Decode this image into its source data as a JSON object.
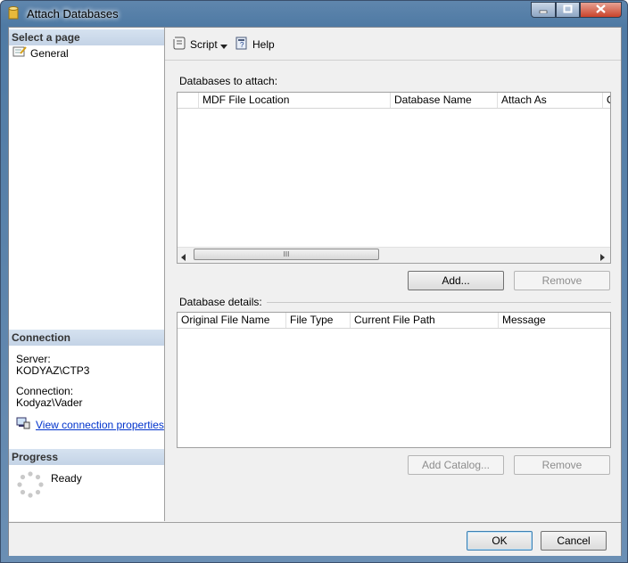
{
  "window": {
    "title": "Attach Databases",
    "icon": "database-cylinder-icon",
    "minimize_icon": "minimize-icon",
    "maximize_icon": "maximize-icon",
    "close_icon": "close-icon"
  },
  "sidebar": {
    "select_page_header": "Select a page",
    "pages": [
      {
        "label": "General",
        "icon": "general-page-icon"
      }
    ],
    "connection_header": "Connection",
    "server_label": "Server:",
    "server_value": "KODYAZ\\CTP3",
    "connection_label": "Connection:",
    "connection_value": "Kodyaz\\Vader",
    "view_connection_link": "View connection properties",
    "progress_header": "Progress",
    "progress_status": "Ready"
  },
  "toolbar": {
    "script_label": "Script",
    "help_label": "Help"
  },
  "databases_to_attach": {
    "label": "Databases to attach:",
    "columns": [
      "",
      "MDF File Location",
      "Database Name",
      "Attach As",
      "O"
    ],
    "rows": [],
    "scroll_grip": "III",
    "add_button": "Add...",
    "remove_button": "Remove"
  },
  "database_details": {
    "label": "Database details:",
    "columns": [
      "Original File Name",
      "File Type",
      "Current File Path",
      "Message"
    ],
    "rows": [],
    "add_catalog_button": "Add Catalog...",
    "remove_button": "Remove"
  },
  "footer": {
    "ok_button": "OK",
    "cancel_button": "Cancel"
  },
  "colors": {
    "accent": "#c4d3e6",
    "link": "#0033cc",
    "titlebar": "#5f86ad"
  }
}
